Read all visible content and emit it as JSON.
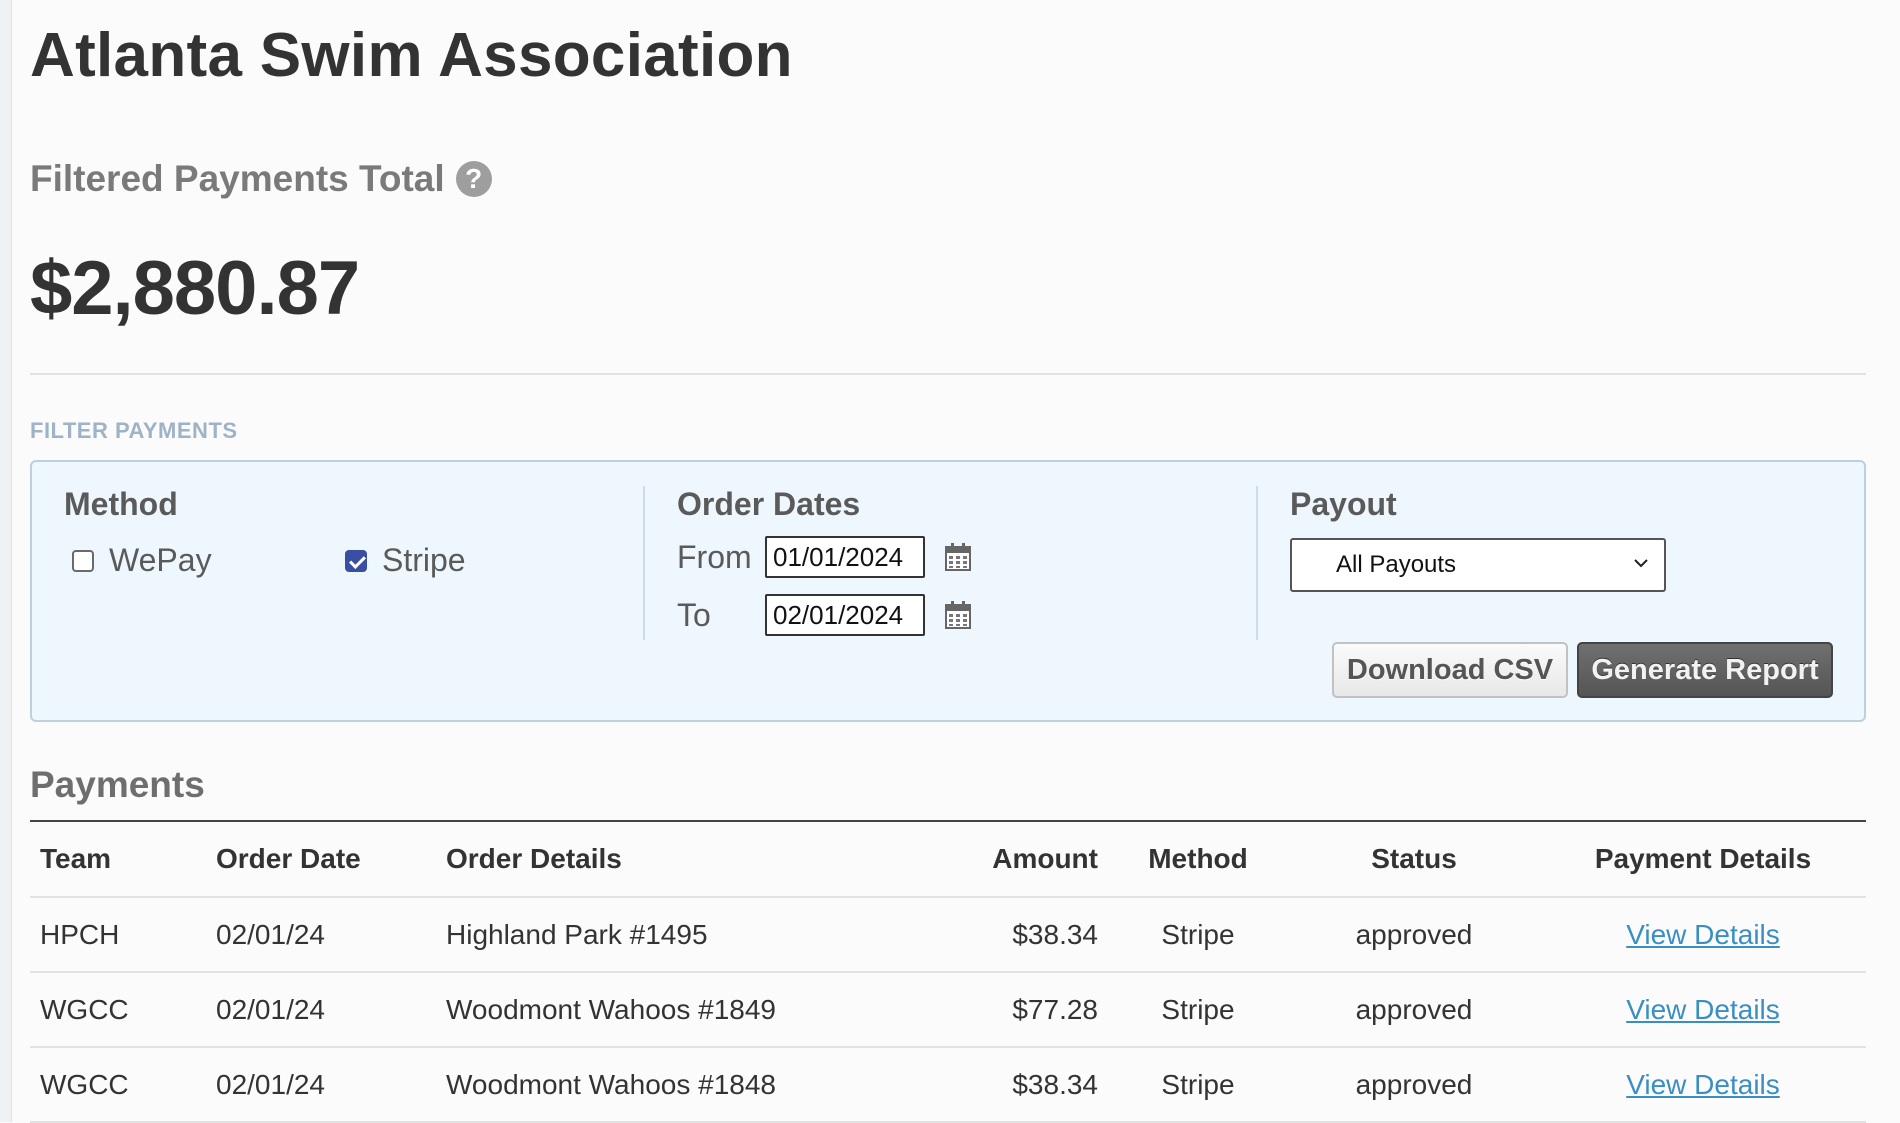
{
  "org": {
    "title": "Atlanta Swim Association"
  },
  "summary": {
    "total_label": "Filtered Payments Total",
    "help_icon": "?",
    "total_amount": "$2,880.87"
  },
  "filters": {
    "heading": "FILTER PAYMENTS",
    "method": {
      "label": "Method",
      "options": [
        {
          "label": "WePay",
          "checked": false
        },
        {
          "label": "Stripe",
          "checked": true
        }
      ]
    },
    "order_dates": {
      "label": "Order Dates",
      "from_label": "From",
      "from_value": "01/01/2024",
      "to_label": "To",
      "to_value": "02/01/2024",
      "calendar_icon": "calendar-icon"
    },
    "payout": {
      "label": "Payout",
      "selected": "All Payouts"
    },
    "buttons": {
      "download_csv": "Download CSV",
      "generate_report": "Generate Report"
    }
  },
  "payments": {
    "heading": "Payments",
    "columns": [
      "Team",
      "Order Date",
      "Order Details",
      "Amount",
      "Method",
      "Status",
      "Payment Details"
    ],
    "rows": [
      {
        "team": "HPCH",
        "order_date": "02/01/24",
        "order_details": "Highland Park #1495",
        "amount": "$38.34",
        "method": "Stripe",
        "status": "approved",
        "link": "View Details"
      },
      {
        "team": "WGCC",
        "order_date": "02/01/24",
        "order_details": "Woodmont Wahoos #1849",
        "amount": "$77.28",
        "method": "Stripe",
        "status": "approved",
        "link": "View Details"
      },
      {
        "team": "WGCC",
        "order_date": "02/01/24",
        "order_details": "Woodmont Wahoos #1848",
        "amount": "$38.34",
        "method": "Stripe",
        "status": "approved",
        "link": "View Details"
      }
    ]
  },
  "colors": {
    "filter_box_bg": "#eef7fd",
    "filter_heading": "#9fb3c6",
    "link": "#3a8ec4",
    "checkbox_checked": "#3a4fa3"
  }
}
